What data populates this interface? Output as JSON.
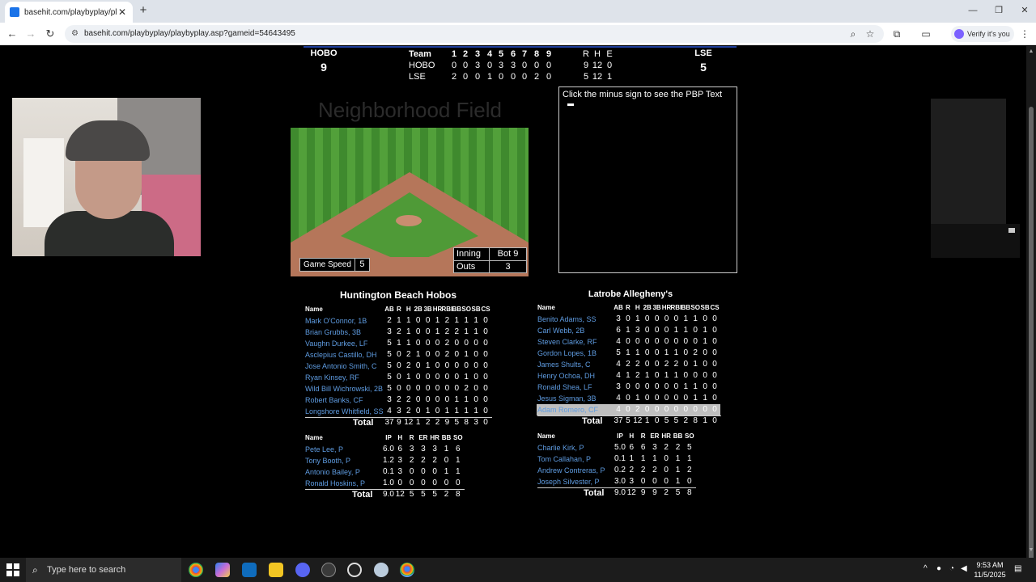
{
  "browser": {
    "tab_title": "basehit.com/playbyplay/playby",
    "url": "basehit.com/playbyplay/playbyplay.asp?gameid=54643495",
    "profile_label": "Verify it's you"
  },
  "scoreboard": {
    "away_abbr": "HOBO",
    "away_score": "9",
    "home_abbr": "LSE",
    "home_score": "5",
    "linescore": {
      "header": {
        "team": "Team",
        "innings": [
          "1",
          "2",
          "3",
          "4",
          "5",
          "6",
          "7",
          "8",
          "9"
        ],
        "r": "R",
        "h": "H",
        "e": "E"
      },
      "rows": [
        {
          "team": "HOBO",
          "innings": [
            "0",
            "0",
            "3",
            "0",
            "3",
            "3",
            "0",
            "0",
            "0"
          ],
          "r": "9",
          "h": "12",
          "e": "0"
        },
        {
          "team": "LSE",
          "innings": [
            "2",
            "0",
            "0",
            "1",
            "0",
            "0",
            "0",
            "2",
            "0"
          ],
          "r": "5",
          "h": "12",
          "e": "1"
        }
      ]
    }
  },
  "field": {
    "title": "Neighborhood Field",
    "game_speed_label": "Game Speed",
    "game_speed_value": "5",
    "inning_label": "Inning",
    "inning_value": "Bot 9",
    "outs_label": "Outs",
    "outs_value": "3"
  },
  "pbp": {
    "text": "Click the minus sign to see the PBP Text"
  },
  "away": {
    "name": "Huntington Beach Hobos",
    "batting_headers": [
      "Name",
      "AB",
      "R",
      "H",
      "2B",
      "3B",
      "HR",
      "RBI",
      "BB",
      "SO",
      "SB",
      "CS"
    ],
    "batters": [
      [
        "Mark O'Connor, 1B",
        "2",
        "1",
        "1",
        "0",
        "0",
        "1",
        "2",
        "1",
        "1",
        "1",
        "0"
      ],
      [
        "Brian Grubbs, 3B",
        "3",
        "2",
        "1",
        "0",
        "0",
        "1",
        "2",
        "2",
        "1",
        "1",
        "0"
      ],
      [
        "Vaughn Durkee, LF",
        "5",
        "1",
        "1",
        "0",
        "0",
        "0",
        "2",
        "0",
        "0",
        "0",
        "0"
      ],
      [
        "Asclepius Castillo, DH",
        "5",
        "0",
        "2",
        "1",
        "0",
        "0",
        "2",
        "0",
        "1",
        "0",
        "0"
      ],
      [
        "Jose Antonio Smith, C",
        "5",
        "0",
        "2",
        "0",
        "1",
        "0",
        "0",
        "0",
        "0",
        "0",
        "0"
      ],
      [
        "Ryan Kinsey, RF",
        "5",
        "0",
        "1",
        "0",
        "0",
        "0",
        "0",
        "0",
        "1",
        "0",
        "0"
      ],
      [
        "Wild Bill Wichrowski, 2B",
        "5",
        "0",
        "0",
        "0",
        "0",
        "0",
        "0",
        "0",
        "2",
        "0",
        "0"
      ],
      [
        "Robert Banks, CF",
        "3",
        "2",
        "2",
        "0",
        "0",
        "0",
        "0",
        "1",
        "1",
        "0",
        "0"
      ],
      [
        "Longshore Whitfield, SS",
        "4",
        "3",
        "2",
        "0",
        "1",
        "0",
        "1",
        "1",
        "1",
        "1",
        "0"
      ]
    ],
    "batting_total": [
      "Total",
      "37",
      "9",
      "12",
      "1",
      "2",
      "2",
      "9",
      "5",
      "8",
      "3",
      "0"
    ],
    "pitching_headers": [
      "Name",
      "IP",
      "H",
      "R",
      "ER",
      "HR",
      "BB",
      "SO"
    ],
    "pitchers": [
      [
        "Pete Lee, P",
        "6.0",
        "6",
        "3",
        "3",
        "3",
        "1",
        "6"
      ],
      [
        "Tony Booth, P",
        "1.2",
        "3",
        "2",
        "2",
        "2",
        "0",
        "1"
      ],
      [
        "Antonio Bailey, P",
        "0.1",
        "3",
        "0",
        "0",
        "0",
        "1",
        "1"
      ],
      [
        "Ronald Hoskins, P",
        "1.0",
        "0",
        "0",
        "0",
        "0",
        "0",
        "0"
      ]
    ],
    "pitching_total": [
      "Total",
      "9.0",
      "12",
      "5",
      "5",
      "5",
      "2",
      "8"
    ]
  },
  "home": {
    "name": "Latrobe Allegheny's",
    "batting_headers": [
      "Name",
      "AB",
      "R",
      "H",
      "2B",
      "3B",
      "HR",
      "RBI",
      "BB",
      "SO",
      "SB",
      "CS"
    ],
    "batters": [
      [
        "Benito Adams, SS",
        "3",
        "0",
        "1",
        "0",
        "0",
        "0",
        "0",
        "1",
        "1",
        "0",
        "0"
      ],
      [
        "Carl Webb, 2B",
        "6",
        "1",
        "3",
        "0",
        "0",
        "0",
        "1",
        "1",
        "0",
        "1",
        "0"
      ],
      [
        "Steven Clarke, RF",
        "4",
        "0",
        "0",
        "0",
        "0",
        "0",
        "0",
        "0",
        "0",
        "1",
        "0"
      ],
      [
        "Gordon Lopes, 1B",
        "5",
        "1",
        "1",
        "0",
        "0",
        "1",
        "1",
        "0",
        "2",
        "0",
        "0"
      ],
      [
        "James Shults, C",
        "4",
        "2",
        "2",
        "0",
        "0",
        "2",
        "2",
        "0",
        "1",
        "0",
        "0"
      ],
      [
        "Henry Ochoa, DH",
        "4",
        "1",
        "2",
        "1",
        "0",
        "1",
        "1",
        "0",
        "0",
        "0",
        "0"
      ],
      [
        "Ronald Shea, LF",
        "3",
        "0",
        "0",
        "0",
        "0",
        "0",
        "0",
        "1",
        "1",
        "0",
        "0"
      ],
      [
        "Jesus Sigman, 3B",
        "4",
        "0",
        "1",
        "0",
        "0",
        "0",
        "0",
        "0",
        "1",
        "1",
        "0"
      ],
      [
        "Adam Romero, CF",
        "4",
        "0",
        "2",
        "0",
        "0",
        "0",
        "0",
        "0",
        "0",
        "0",
        "0"
      ]
    ],
    "batting_total": [
      "Total",
      "37",
      "5",
      "12",
      "1",
      "0",
      "5",
      "5",
      "2",
      "8",
      "1",
      "0"
    ],
    "pitching_headers": [
      "Name",
      "IP",
      "H",
      "R",
      "ER",
      "HR",
      "BB",
      "SO"
    ],
    "pitchers": [
      [
        "Charlie Kirk, P",
        "5.0",
        "6",
        "6",
        "3",
        "2",
        "2",
        "5"
      ],
      [
        "Tom Callahan, P",
        "0.1",
        "1",
        "1",
        "1",
        "0",
        "1",
        "1"
      ],
      [
        "Andrew Contreras, P",
        "0.2",
        "2",
        "2",
        "2",
        "0",
        "1",
        "2"
      ],
      [
        "Joseph Silvester, P",
        "3.0",
        "3",
        "0",
        "0",
        "0",
        "1",
        "0"
      ]
    ],
    "pitching_total": [
      "Total",
      "9.0",
      "12",
      "9",
      "9",
      "2",
      "5",
      "8"
    ]
  },
  "taskbar": {
    "search_placeholder": "Type here to search",
    "time": "9:53 AM",
    "date": "11/5/2025"
  }
}
